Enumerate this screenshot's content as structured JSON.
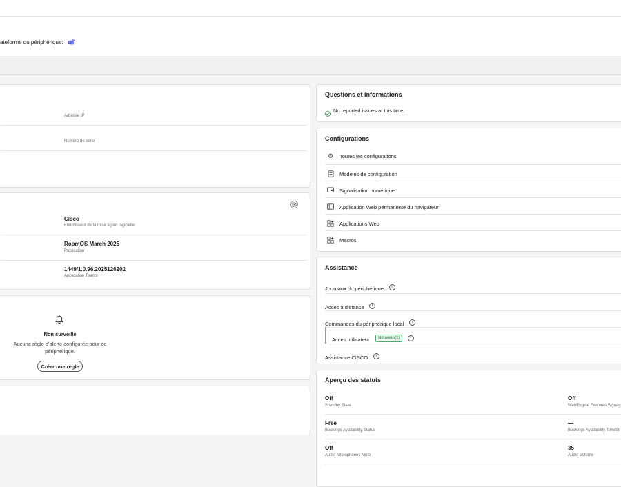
{
  "header": {
    "platform_label": "ateforme du périphérique:",
    "platform_icon": "microsoft-teams-icon"
  },
  "info_card": {
    "fields": [
      {
        "label": "Adresse IP"
      },
      {
        "label": "Numéro de série"
      }
    ]
  },
  "software_card": {
    "settings_icon": "gear-icon",
    "fields": [
      {
        "value": "Cisco",
        "label": "Fournisseur de la mise à jour logicielle"
      },
      {
        "value": "RoomOS March 2025",
        "label": "Publication"
      },
      {
        "value": "1449/1.0.96.2025126202",
        "label": "Application Teams"
      }
    ]
  },
  "alerts_card": {
    "icon": "bell-icon",
    "title": "Non surveillé",
    "description_line1": "Aucune règle d'alerte configurée pour ce",
    "description_line2": "périphérique.",
    "create_button": "Créer une règle"
  },
  "issues_card": {
    "title": "Questions et informations",
    "status": "No reported issues at this time."
  },
  "configurations": {
    "title": "Configurations",
    "items": [
      {
        "label": "Toutes les configurations",
        "icon": "gear-icon"
      },
      {
        "label": "Modèles de configuration",
        "icon": "document-icon"
      },
      {
        "label": "Signalisation numérique",
        "icon": "display-icon"
      },
      {
        "label": "Application Web permanente du navigateur",
        "icon": "browser-icon"
      },
      {
        "label": "Applications Web",
        "icon": "apps-icon"
      },
      {
        "label": "Macros",
        "icon": "apps-icon"
      }
    ]
  },
  "assistance": {
    "title": "Assistance",
    "items": [
      {
        "label": "Journaux du périphérique"
      },
      {
        "label": "Accès à distance"
      },
      {
        "label": "Commandes du périphérique local"
      },
      {
        "label": "Accès utilisateur",
        "badge": "Nouveau(x)"
      },
      {
        "label": "Assistance CISCO"
      }
    ]
  },
  "status_overview": {
    "title": "Aperçu des statuts",
    "rows": [
      [
        {
          "value": "Off",
          "label": "Standby State"
        },
        {
          "value": "Off",
          "label": "WebEngine Features Signag"
        }
      ],
      [
        {
          "value": "Free",
          "label": "Bookings Availability Status"
        },
        {
          "value": "—",
          "label": "Bookings Availability TimeSt"
        }
      ],
      [
        {
          "value": "Off",
          "label": "Audio Microphones Mute"
        },
        {
          "value": "35",
          "label": "Audio Volume"
        }
      ]
    ]
  },
  "colors": {
    "accent_green": "#1d7a3a",
    "teams_purple": "#5059c9"
  }
}
